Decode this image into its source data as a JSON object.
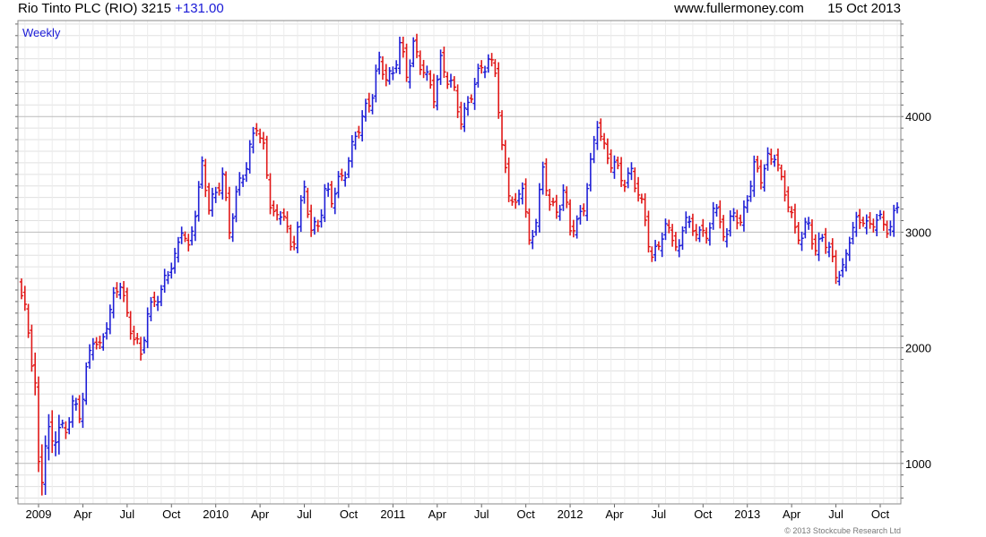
{
  "header": {
    "title": "Rio Tinto PLC (RIO)",
    "price": "3215",
    "change": "+131.00",
    "website": "www.fullermoney.com",
    "date": "15 Oct 2013"
  },
  "copyright": "© 2013 Stockcube Research Ltd",
  "colors": {
    "up": "#1f1fd6",
    "down": "#e01818",
    "grid": "#e0e0e0",
    "grid_major": "#bcbcbc",
    "frame": "#8a8a8a"
  },
  "chart_data": {
    "type": "ohlc",
    "period_label": "Weekly",
    "y_axis_side": "right",
    "grid": true,
    "ylim": [
      650,
      4830
    ],
    "y_ticks": [
      1000,
      2000,
      3000,
      4000
    ],
    "x_labels": [
      "2009",
      "Apr",
      "Jul",
      "Oct",
      "2010",
      "Apr",
      "Jul",
      "Oct",
      "2011",
      "Apr",
      "Jul",
      "Oct",
      "2012",
      "Apr",
      "Jul",
      "Oct",
      "2013",
      "Apr",
      "Jul",
      "Oct"
    ],
    "x_label_weeks": [
      5,
      18,
      31,
      44,
      57,
      70,
      83,
      96,
      109,
      122,
      135,
      148,
      161,
      174,
      187,
      200,
      213,
      226,
      239,
      252
    ],
    "week_count": 258,
    "close_anchors": [
      [
        0,
        2450
      ],
      [
        2,
        2150
      ],
      [
        4,
        1700
      ],
      [
        5,
        980
      ],
      [
        6,
        850
      ],
      [
        7,
        1150
      ],
      [
        8,
        1250
      ],
      [
        9,
        1180
      ],
      [
        11,
        1350
      ],
      [
        13,
        1250
      ],
      [
        15,
        1500
      ],
      [
        17,
        1450
      ],
      [
        19,
        1800
      ],
      [
        21,
        2050
      ],
      [
        23,
        2000
      ],
      [
        25,
        2250
      ],
      [
        27,
        2400
      ],
      [
        29,
        2550
      ],
      [
        31,
        2300
      ],
      [
        33,
        2100
      ],
      [
        35,
        1900
      ],
      [
        37,
        2300
      ],
      [
        39,
        2450
      ],
      [
        41,
        2450
      ],
      [
        43,
        2650
      ],
      [
        45,
        2800
      ],
      [
        47,
        3050
      ],
      [
        49,
        2800
      ],
      [
        51,
        3200
      ],
      [
        53,
        3600
      ],
      [
        55,
        3200
      ],
      [
        57,
        3300
      ],
      [
        59,
        3550
      ],
      [
        61,
        3000
      ],
      [
        63,
        3300
      ],
      [
        65,
        3500
      ],
      [
        67,
        3750
      ],
      [
        69,
        3900
      ],
      [
        71,
        3700
      ],
      [
        73,
        3300
      ],
      [
        75,
        3100
      ],
      [
        77,
        3150
      ],
      [
        79,
        2850
      ],
      [
        81,
        3100
      ],
      [
        83,
        3350
      ],
      [
        85,
        3000
      ],
      [
        87,
        3100
      ],
      [
        89,
        3350
      ],
      [
        91,
        3250
      ],
      [
        93,
        3450
      ],
      [
        95,
        3550
      ],
      [
        97,
        3700
      ],
      [
        99,
        3900
      ],
      [
        101,
        4100
      ],
      [
        103,
        4200
      ],
      [
        105,
        4450
      ],
      [
        107,
        4350
      ],
      [
        109,
        4400
      ],
      [
        111,
        4600
      ],
      [
        113,
        4350
      ],
      [
        115,
        4650
      ],
      [
        117,
        4450
      ],
      [
        119,
        4300
      ],
      [
        121,
        4200
      ],
      [
        123,
        4500
      ],
      [
        125,
        4300
      ],
      [
        127,
        4200
      ],
      [
        129,
        4000
      ],
      [
        131,
        4100
      ],
      [
        133,
        4250
      ],
      [
        135,
        4450
      ],
      [
        137,
        4500
      ],
      [
        139,
        4380
      ],
      [
        141,
        3700
      ],
      [
        143,
        3400
      ],
      [
        145,
        3200
      ],
      [
        147,
        3400
      ],
      [
        149,
        2900
      ],
      [
        151,
        3150
      ],
      [
        153,
        3500
      ],
      [
        155,
        3250
      ],
      [
        157,
        3200
      ],
      [
        159,
        3350
      ],
      [
        161,
        3000
      ],
      [
        163,
        3100
      ],
      [
        165,
        3250
      ],
      [
        167,
        3550
      ],
      [
        169,
        3950
      ],
      [
        171,
        3750
      ],
      [
        173,
        3600
      ],
      [
        175,
        3500
      ],
      [
        177,
        3450
      ],
      [
        179,
        3550
      ],
      [
        181,
        3300
      ],
      [
        183,
        3100
      ],
      [
        185,
        2800
      ],
      [
        187,
        2900
      ],
      [
        189,
        3000
      ],
      [
        191,
        3000
      ],
      [
        193,
        2850
      ],
      [
        195,
        3150
      ],
      [
        197,
        2950
      ],
      [
        199,
        3100
      ],
      [
        201,
        2900
      ],
      [
        203,
        3200
      ],
      [
        205,
        3100
      ],
      [
        207,
        3000
      ],
      [
        209,
        3150
      ],
      [
        211,
        3050
      ],
      [
        213,
        3350
      ],
      [
        215,
        3550
      ],
      [
        217,
        3450
      ],
      [
        219,
        3650
      ],
      [
        221,
        3700
      ],
      [
        223,
        3400
      ],
      [
        225,
        3250
      ],
      [
        227,
        3050
      ],
      [
        229,
        2950
      ],
      [
        231,
        3050
      ],
      [
        233,
        2850
      ],
      [
        235,
        3000
      ],
      [
        237,
        2800
      ],
      [
        239,
        2650
      ],
      [
        241,
        2700
      ],
      [
        243,
        2950
      ],
      [
        245,
        3050
      ],
      [
        247,
        3150
      ],
      [
        249,
        3050
      ],
      [
        251,
        3100
      ],
      [
        253,
        3050
      ],
      [
        255,
        3084
      ],
      [
        257,
        3215
      ]
    ]
  }
}
